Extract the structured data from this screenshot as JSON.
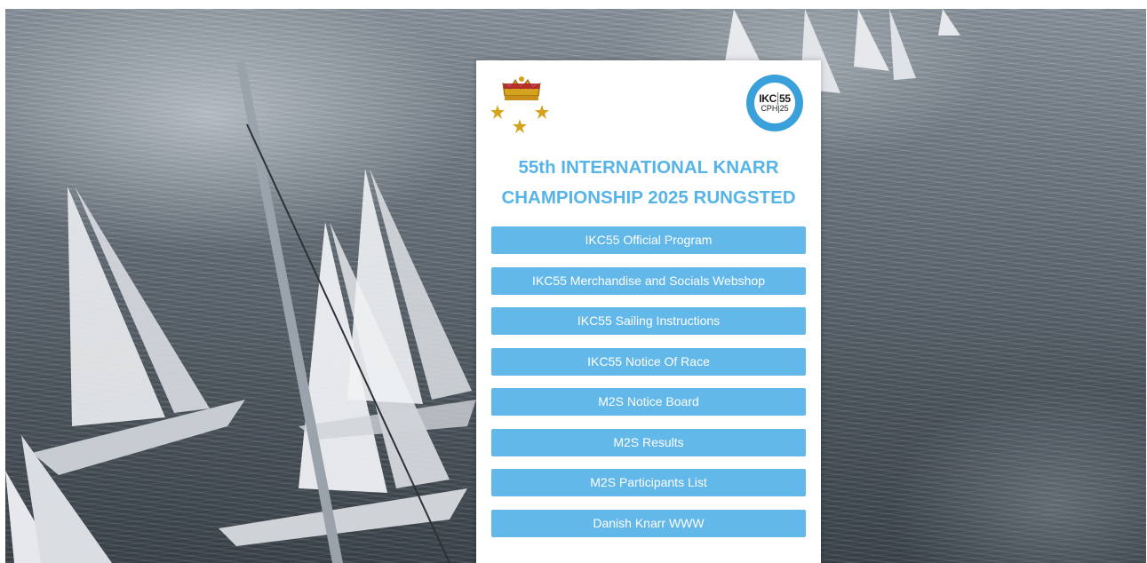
{
  "header": {
    "title_line1": "55th INTERNATIONAL KNARR",
    "title_line2": "CHAMPIONSHIP 2025 RUNGSTED"
  },
  "logo": {
    "top_left": "IKC",
    "top_right": "55",
    "bottom_left": "CPH",
    "bottom_right": "25"
  },
  "links": [
    {
      "label": "IKC55 Official Program"
    },
    {
      "label": "IKC55 Merchandise and Socials Webshop"
    },
    {
      "label": "IKC55 Sailing Instructions"
    },
    {
      "label": "IKC55 Notice Of Race"
    },
    {
      "label": "M2S Notice Board"
    },
    {
      "label": "M2S Results"
    },
    {
      "label": "M2S Participants List"
    },
    {
      "label": "Danish Knarr WWW"
    }
  ],
  "colors": {
    "accent": "#56b4e9",
    "button": "#63b8ea",
    "logo_ring": "#3aa0dc"
  },
  "icons": [
    "crown-crest-icon",
    "ikc55-logo-icon"
  ]
}
